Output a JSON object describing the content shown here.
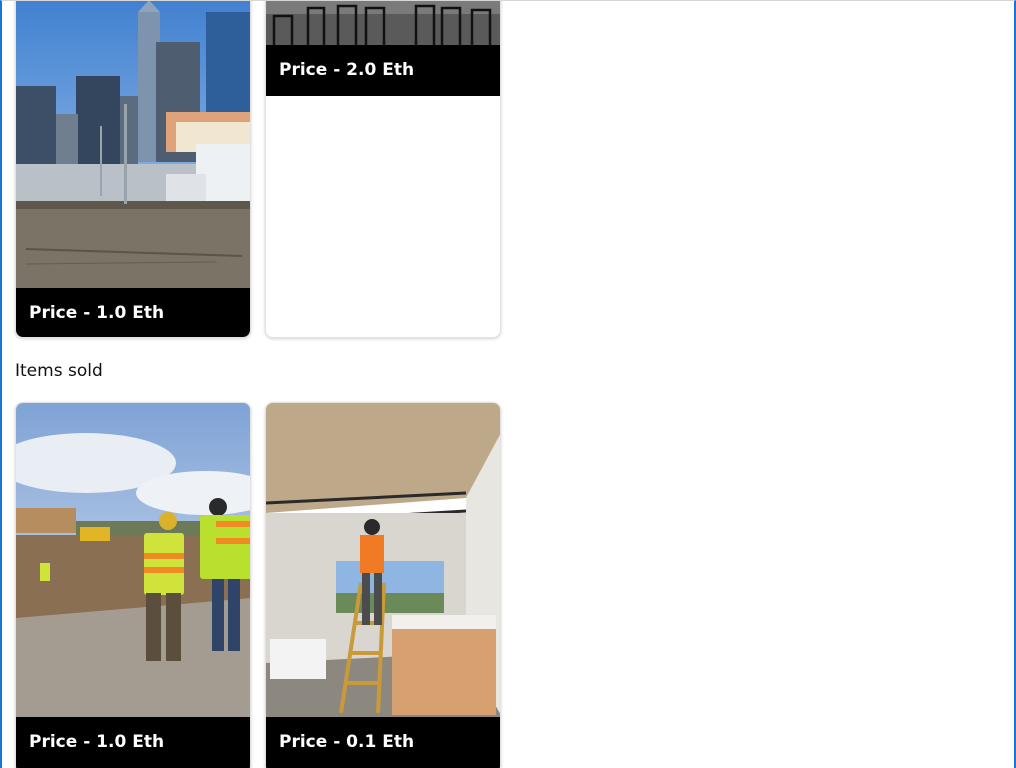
{
  "listed_items": [
    {
      "price_label": "Price - 1.0 Eth",
      "photo": "city-skyline-photo"
    },
    {
      "price_label": "Price - 2.0 Eth",
      "photo": "chairs-photo"
    }
  ],
  "sold_section": {
    "heading": "Items sold",
    "items": [
      {
        "price_label": "Price - 1.0 Eth",
        "photo": "construction-site-photo"
      },
      {
        "price_label": "Price - 0.1 Eth",
        "photo": "interior-construction-photo"
      }
    ]
  },
  "colors": {
    "frame_accent": "#1a73d9",
    "price_bar": "#000000",
    "price_text": "#ffffff"
  }
}
